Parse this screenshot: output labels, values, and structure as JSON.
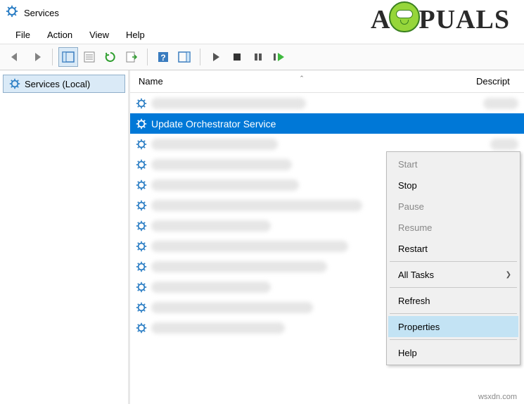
{
  "window": {
    "title": "Services"
  },
  "menubar": [
    "File",
    "Action",
    "View",
    "Help"
  ],
  "tree": {
    "root_label": "Services (Local)"
  },
  "columns": {
    "name": "Name",
    "description": "Descript"
  },
  "selected_service": "Update Orchestrator Service",
  "blurred_rows_before": 1,
  "blurred_rows_after": 10,
  "context_menu": {
    "items": [
      {
        "label": "Start",
        "enabled": false,
        "submenu": false
      },
      {
        "label": "Stop",
        "enabled": true,
        "submenu": false
      },
      {
        "label": "Pause",
        "enabled": false,
        "submenu": false
      },
      {
        "label": "Resume",
        "enabled": false,
        "submenu": false
      },
      {
        "label": "Restart",
        "enabled": true,
        "submenu": false
      },
      {
        "sep": true
      },
      {
        "label": "All Tasks",
        "enabled": true,
        "submenu": true
      },
      {
        "sep": true
      },
      {
        "label": "Refresh",
        "enabled": true,
        "submenu": false
      },
      {
        "sep": true
      },
      {
        "label": "Properties",
        "enabled": true,
        "submenu": false,
        "highlighted": true
      },
      {
        "sep": true
      },
      {
        "label": "Help",
        "enabled": true,
        "submenu": false
      }
    ]
  },
  "watermark": {
    "prefix": "A",
    "suffix": "PUALS"
  },
  "footer": {
    "url": "wsxdn.com"
  }
}
